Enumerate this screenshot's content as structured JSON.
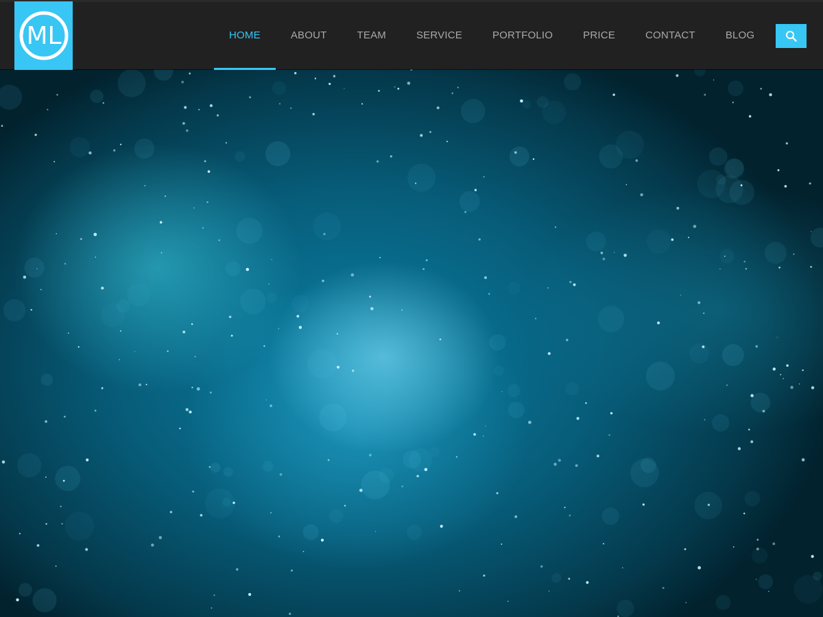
{
  "logo": {
    "text": "ML",
    "brand_color": "#38c6f4"
  },
  "nav": {
    "items": [
      {
        "label": "HOME",
        "active": true
      },
      {
        "label": "ABOUT",
        "active": false
      },
      {
        "label": "TEAM",
        "active": false
      },
      {
        "label": "SERVICE",
        "active": false
      },
      {
        "label": "PORTFOLIO",
        "active": false
      },
      {
        "label": "PRICE",
        "active": false
      },
      {
        "label": "CONTACT",
        "active": false
      },
      {
        "label": "BLOG",
        "active": false
      }
    ],
    "text_color": "#a9a9a9",
    "active_color": "#38c6f4",
    "background": "#212121"
  },
  "search": {
    "icon": "search-icon"
  },
  "hero": {
    "background": "blue particle nebula",
    "accent": "#0b7ea2"
  }
}
